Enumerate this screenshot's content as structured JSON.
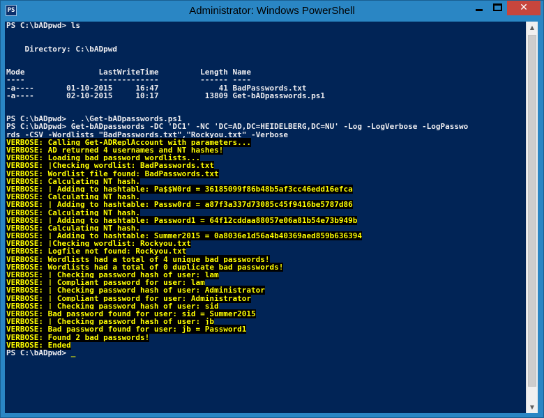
{
  "window": {
    "title": "Administrator: Windows PowerShell",
    "icon_label": "PS",
    "controls": {
      "close_glyph": "✕"
    }
  },
  "console": {
    "lines": [
      {
        "t": "PS C:\\bADpwd> ls",
        "v": false
      },
      {
        "t": "",
        "v": false
      },
      {
        "t": "",
        "v": false
      },
      {
        "t": "    Directory: C:\\bADpwd",
        "v": false
      },
      {
        "t": "",
        "v": false
      },
      {
        "t": "",
        "v": false
      },
      {
        "t": "Mode                LastWriteTime         Length Name",
        "v": false
      },
      {
        "t": "----                -------------         ------ ----",
        "v": false
      },
      {
        "t": "-a----       01-10-2015     16:47             41 BadPasswords.txt",
        "v": false
      },
      {
        "t": "-a----       02-10-2015     10:17          13809 Get-bADpasswords.ps1",
        "v": false
      },
      {
        "t": "",
        "v": false
      },
      {
        "t": "",
        "v": false
      },
      {
        "t": "PS C:\\bADpwd> . .\\Get-bADpasswords.ps1",
        "v": false
      },
      {
        "t": "PS C:\\bADpwd> Get-bADpasswords -DC 'DC1' -NC 'DC=AD,DC=HEIDELBERG,DC=NU' -Log -LogVerbose -LogPasswo",
        "v": false
      },
      {
        "t": "rds -CSV -Wordlists \"BadPasswords.txt\",\"Rockyou.txt\" -Verbose",
        "v": false
      },
      {
        "t": "VERBOSE: Calling Get-ADReplAccount with parameters...",
        "v": true
      },
      {
        "t": "VERBOSE: AD returned 4 usernames and NT hashes!",
        "v": true
      },
      {
        "t": "VERBOSE: Loading bad password wordlists...",
        "v": true
      },
      {
        "t": "VERBOSE: |Checking wordlist: BadPasswords.txt",
        "v": true
      },
      {
        "t": "VERBOSE: Wordlist file found: BadPasswords.txt",
        "v": true
      },
      {
        "t": "VERBOSE: Calculating NT hash.",
        "v": true
      },
      {
        "t": "VERBOSE: | Adding to hashtable: Pa$$W0rd = 36185099f86b48b5af3cc46edd16efca",
        "v": true
      },
      {
        "t": "VERBOSE: Calculating NT hash.",
        "v": true
      },
      {
        "t": "VERBOSE: | Adding to hashtable: Passw0rd = a87f3a337d73085c45f9416be5787d86",
        "v": true
      },
      {
        "t": "VERBOSE: Calculating NT hash.",
        "v": true
      },
      {
        "t": "VERBOSE: | Adding to hashtable: Password1 = 64f12cddaa88057e06a81b54e73b949b",
        "v": true
      },
      {
        "t": "VERBOSE: Calculating NT hash.",
        "v": true
      },
      {
        "t": "VERBOSE: | Adding to hashtable: Summer2015 = 0a8036e1d56a4b40369aed859b636394",
        "v": true
      },
      {
        "t": "VERBOSE: |Checking wordlist: Rockyou.txt",
        "v": true
      },
      {
        "t": "VERBOSE: Logfile not found: Rockyou.txt",
        "v": true
      },
      {
        "t": "VERBOSE: Wordlists had a total of 4 unique bad passwords!",
        "v": true
      },
      {
        "t": "VERBOSE: Wordlists had a total of 0 duplicate bad passwords!",
        "v": true
      },
      {
        "t": "VERBOSE: | Checking password hash of user: lam",
        "v": true
      },
      {
        "t": "VERBOSE: | Compliant password for user: lam",
        "v": true
      },
      {
        "t": "VERBOSE: | Checking password hash of user: Administrator",
        "v": true
      },
      {
        "t": "VERBOSE: | Compliant password for user: Administrator",
        "v": true
      },
      {
        "t": "VERBOSE: | Checking password hash of user: sid",
        "v": true
      },
      {
        "t": "VERBOSE: Bad password found for user: sid = Summer2015",
        "v": true
      },
      {
        "t": "VERBOSE: | Checking password hash of user: jb",
        "v": true
      },
      {
        "t": "VERBOSE: Bad password found for user: jb = Password1",
        "v": true
      },
      {
        "t": "VERBOSE: Found 2 bad passwords!",
        "v": true
      },
      {
        "t": "VERBOSE: Ended",
        "v": true
      }
    ],
    "prompt": "PS C:\\bADpwd> ",
    "cursor": "_",
    "colors": {
      "background": "#012456",
      "text": "#eeedf0",
      "verbose_fg": "#ffff00",
      "verbose_bg": "#000000"
    }
  },
  "scrollbar": {
    "up_glyph": "▲",
    "down_glyph": "▼"
  }
}
